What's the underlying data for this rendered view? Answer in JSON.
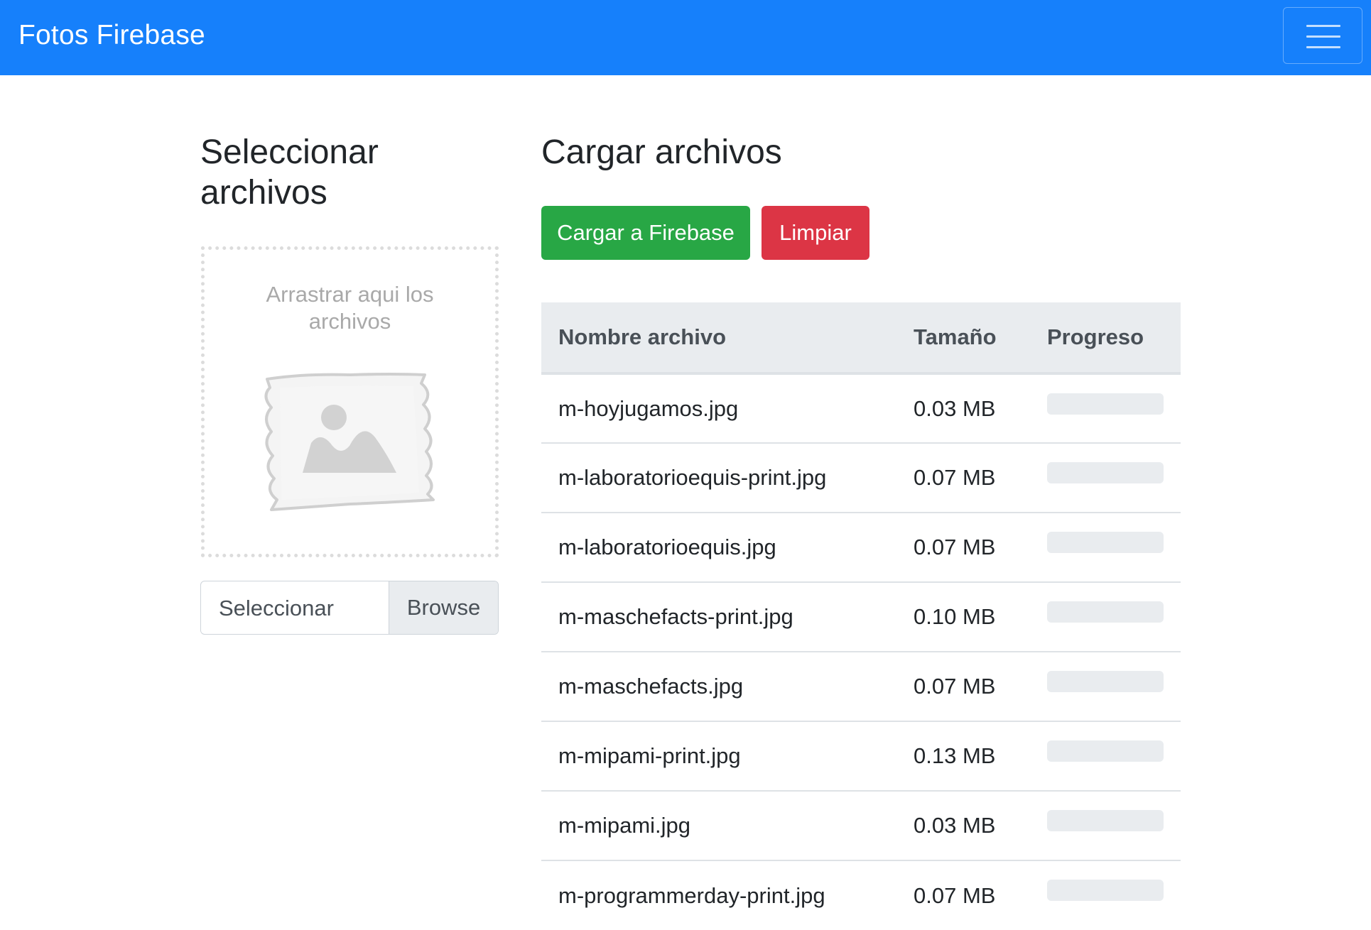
{
  "navbar": {
    "brand": "Fotos Firebase",
    "toggler_icon": "hamburger-menu-icon",
    "background": "#1680fb"
  },
  "left": {
    "title": "Seleccionar archivos",
    "dropzone": {
      "text_line1": "Arrastrar aqui los",
      "text_line2": "archivos",
      "image_icon": "image-placeholder-icon"
    },
    "file_input": {
      "label": "Seleccionar",
      "browse_label": "Browse"
    }
  },
  "right": {
    "title": "Cargar archivos",
    "buttons": {
      "upload_label": "Cargar a Firebase",
      "upload_color": "#28a745",
      "clear_label": "Limpiar",
      "clear_color": "#dc3545"
    },
    "table": {
      "headers": {
        "name": "Nombre archivo",
        "size": "Tamaño",
        "progress": "Progreso"
      },
      "rows": [
        {
          "name": "m-hoyjugamos.jpg",
          "size": "0.03 MB",
          "progress": 0
        },
        {
          "name": "m-laboratorioequis-print.jpg",
          "size": "0.07 MB",
          "progress": 0
        },
        {
          "name": "m-laboratorioequis.jpg",
          "size": "0.07 MB",
          "progress": 0
        },
        {
          "name": "m-maschefacts-print.jpg",
          "size": "0.10 MB",
          "progress": 0
        },
        {
          "name": "m-maschefacts.jpg",
          "size": "0.07 MB",
          "progress": 0
        },
        {
          "name": "m-mipami-print.jpg",
          "size": "0.13 MB",
          "progress": 0
        },
        {
          "name": "m-mipami.jpg",
          "size": "0.03 MB",
          "progress": 0
        },
        {
          "name": "m-programmerday-print.jpg",
          "size": "0.07 MB",
          "progress": 0
        }
      ]
    }
  }
}
